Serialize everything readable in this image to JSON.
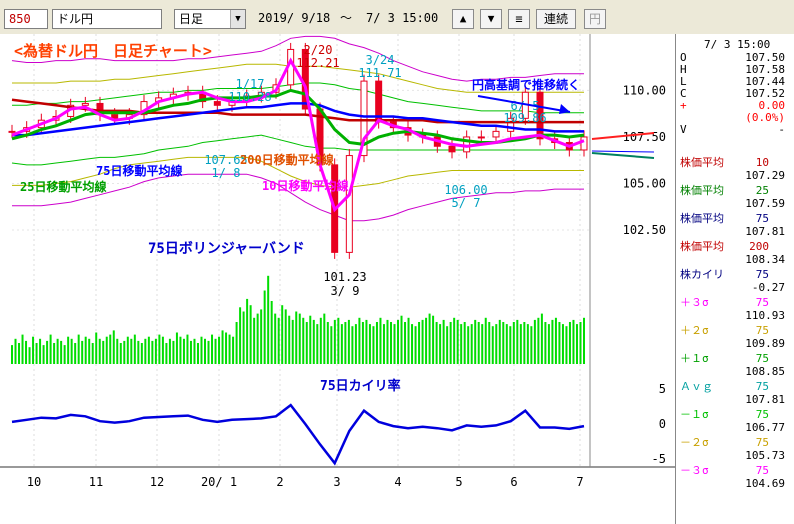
{
  "toolbar": {
    "code": "850",
    "name": "ドル円",
    "period": "日足",
    "date_from": "2019/ 9/18",
    "tilde": "～",
    "date_to": "7/ 3 15:00",
    "up_label": "▲",
    "down_label": "▼",
    "menu_label": "≡",
    "continuous_label": "連続",
    "yen_label": "円"
  },
  "colors": {
    "candle": "#e8001f",
    "ma10": "#ff00ff",
    "ma25": "#00b000",
    "ma75": "#0000ff",
    "ma200": "#c00000",
    "sigma3": "#cc00cc",
    "sigma2": "#b8b800",
    "sigma1": "#00c000",
    "volume": "#00dd00",
    "deviation": "#0000dd"
  },
  "chart_data": [
    {
      "type": "line",
      "title": "<為替ドル円　日足チャート>",
      "xlabel": "",
      "ylabel": "",
      "x_ticks": [
        "10",
        "11",
        "12",
        "20/ 1",
        "2",
        "3",
        "4",
        "5",
        "6",
        "7"
      ],
      "y_ticks": [
        "110.00",
        "107.50",
        "105.00",
        "102.50"
      ],
      "ylim": [
        100.3,
        112.6
      ],
      "series": [
        {
          "name": "株価平均 10",
          "values": [
            107.6,
            107.9,
            108.2,
            108.5,
            109.0,
            109.1,
            108.7,
            108.4,
            108.5,
            108.9,
            109.4,
            109.6,
            109.8,
            109.9,
            109.6,
            109.4,
            109.4,
            109.6,
            110.0,
            111.6,
            110.2,
            106.0,
            103.6,
            104.4,
            107.4,
            108.4,
            108.1,
            107.9,
            107.5,
            107.3,
            107.1,
            107.0,
            107.1,
            107.2,
            107.4,
            107.5,
            107.6,
            107.3,
            107.0,
            107.3
          ]
        },
        {
          "name": "株価平均 25",
          "values": [
            107.4,
            107.6,
            107.9,
            108.1,
            108.4,
            108.7,
            108.8,
            108.8,
            108.8,
            108.8,
            109.0,
            109.2,
            109.3,
            109.5,
            109.6,
            109.6,
            109.6,
            109.7,
            109.7,
            110.0,
            109.8,
            109.0,
            107.9,
            107.2,
            107.1,
            107.5,
            107.7,
            107.8,
            107.7,
            107.6,
            107.4,
            107.3,
            107.2,
            107.2,
            107.3,
            107.4,
            107.6,
            107.6,
            107.5,
            107.6
          ]
        },
        {
          "name": "株価平均 75",
          "values": [
            107.6,
            107.6,
            107.7,
            107.8,
            107.9,
            108.0,
            108.1,
            108.2,
            108.3,
            108.4,
            108.5,
            108.6,
            108.7,
            108.8,
            108.9,
            109.0,
            109.1,
            109.1,
            109.2,
            109.3,
            109.3,
            109.2,
            108.9,
            108.7,
            108.6,
            108.6,
            108.6,
            108.5,
            108.5,
            108.4,
            108.3,
            108.2,
            108.1,
            108.1,
            108.0,
            107.9,
            107.9,
            107.8,
            107.8,
            107.8
          ]
        },
        {
          "name": "株価平均 200",
          "values": [
            109.5,
            109.4,
            109.3,
            109.2,
            109.1,
            109.0,
            108.9,
            108.9,
            108.9,
            108.8,
            108.8,
            108.8,
            108.8,
            108.8,
            108.8,
            108.7,
            108.7,
            108.7,
            108.7,
            108.7,
            108.7,
            108.6,
            108.5,
            108.4,
            108.4,
            108.4,
            108.4,
            108.4,
            108.4,
            108.3,
            108.3,
            108.3,
            108.3,
            108.3,
            108.3,
            108.3,
            108.3,
            108.3,
            108.3,
            108.3
          ]
        },
        {
          "name": "+3σ",
          "values": [
            111.6,
            111.5,
            111.5,
            111.6,
            111.6,
            111.7,
            111.7,
            111.6,
            111.6,
            111.6,
            111.6,
            111.6,
            111.7,
            111.7,
            111.8,
            111.9,
            112.0,
            112.1,
            112.4,
            112.8,
            112.9,
            112.9,
            112.8,
            112.5,
            112.3,
            112.0,
            111.6,
            111.3,
            111.0,
            110.8,
            110.6,
            110.5,
            110.6,
            110.6,
            110.7,
            110.7,
            110.8,
            110.9,
            110.9,
            110.9
          ]
        },
        {
          "name": "+2σ",
          "values": [
            110.4,
            110.4,
            110.4,
            110.4,
            110.5,
            110.5,
            110.5,
            110.6,
            110.6,
            110.7,
            110.8,
            110.9,
            111.0,
            111.1,
            111.2,
            111.3,
            111.4,
            111.4,
            111.4,
            111.3,
            111.3,
            111.3,
            111.2,
            111.1,
            111.0,
            110.9,
            110.7,
            110.5,
            110.3,
            110.1,
            110.0,
            109.9,
            109.9,
            109.9,
            109.9,
            109.9,
            109.9,
            109.9,
            109.9,
            109.9
          ]
        },
        {
          "name": "+1σ",
          "values": [
            109.2,
            109.2,
            109.3,
            109.3,
            109.4,
            109.4,
            109.5,
            109.6,
            109.7,
            109.8,
            109.9,
            109.9,
            110.0,
            110.0,
            110.1,
            110.1,
            110.1,
            110.1,
            110.2,
            110.3,
            110.4,
            110.4,
            110.3,
            110.1,
            110.0,
            109.8,
            109.6,
            109.4,
            109.3,
            109.2,
            109.1,
            109.0,
            108.9,
            108.9,
            108.9,
            108.9,
            108.8,
            108.8,
            108.8,
            108.8
          ]
        },
        {
          "name": "-1σ",
          "values": [
            106.1,
            106.0,
            106.0,
            106.1,
            106.2,
            106.3,
            106.4,
            106.4,
            106.5,
            106.6,
            106.8,
            106.9,
            107.0,
            107.2,
            107.3,
            107.4,
            107.5,
            107.6,
            107.4,
            107.2,
            107.0,
            106.9,
            106.9,
            106.8,
            106.8,
            106.8,
            106.8,
            106.8,
            106.8,
            106.8,
            106.8,
            106.8,
            106.8,
            106.8,
            106.8,
            106.8,
            106.8,
            106.8,
            106.8,
            106.8
          ]
        },
        {
          "name": "-2σ",
          "values": [
            104.9,
            104.9,
            104.9,
            105.0,
            105.1,
            105.3,
            105.5,
            105.8,
            106.0,
            106.1,
            106.2,
            106.3,
            106.4,
            106.4,
            106.4,
            106.4,
            106.4,
            106.2,
            105.8,
            105.4,
            105.1,
            104.9,
            104.8,
            104.8,
            104.9,
            105.0,
            105.2,
            105.4,
            105.5,
            105.6,
            105.7,
            105.7,
            105.7,
            105.7,
            105.7,
            105.7,
            105.7,
            105.7,
            105.7,
            105.7
          ]
        },
        {
          "name": "-3σ",
          "values": [
            103.8,
            103.8,
            103.8,
            103.9,
            104.0,
            104.2,
            104.4,
            104.6,
            104.8,
            105.1,
            105.3,
            105.4,
            105.5,
            105.5,
            105.5,
            105.5,
            105.5,
            105.3,
            105.0,
            104.5,
            104.0,
            103.6,
            103.3,
            103.0,
            103.0,
            103.1,
            103.3,
            103.6,
            103.8,
            104.0,
            104.2,
            104.3,
            104.4,
            104.5,
            104.5,
            104.6,
            104.6,
            104.7,
            104.7,
            104.7
          ]
        },
        {
          "name": "ドル円",
          "values": [
            107.8,
            108.0,
            108.4,
            108.6,
            109.2,
            109.3,
            108.7,
            108.5,
            108.7,
            109.4,
            109.6,
            109.8,
            109.9,
            109.4,
            109.2,
            109.4,
            109.7,
            109.9,
            110.3,
            112.2,
            109.0,
            106.0,
            101.3,
            106.5,
            110.5,
            108.3,
            108.0,
            107.6,
            107.5,
            107.0,
            106.7,
            107.5,
            107.5,
            107.8,
            108.5,
            109.9,
            107.4,
            107.2,
            106.8,
            107.5
          ]
        }
      ],
      "annotations": [
        "2/20\n112.21",
        "3/24\n111.71",
        "1/17\n110.28",
        "6/ 5\n109.86",
        "107.65\n1/ 8",
        "101.23\n3/ 9",
        "106.00\n5/ 7",
        "円高基調で推移続く",
        "75日移動平均線",
        "25日移動平均線",
        "200日移動平均線",
        "10日移動平均線",
        "75日ボリンジャーバンド"
      ]
    },
    {
      "type": "bar",
      "title": "",
      "values": [
        9,
        12,
        10,
        14,
        11,
        8,
        13,
        10,
        12,
        9,
        11,
        14,
        10,
        12,
        11,
        9,
        13,
        12,
        10,
        14,
        11,
        13,
        12,
        10,
        15,
        12,
        11,
        13,
        14,
        16,
        12,
        10,
        11,
        13,
        12,
        14,
        11,
        10,
        12,
        13,
        11,
        12,
        14,
        13,
        10,
        12,
        11,
        15,
        13,
        12,
        14,
        11,
        12,
        10,
        13,
        12,
        11,
        14,
        12,
        13,
        16,
        15,
        14,
        13,
        20,
        27,
        25,
        31,
        28,
        22,
        24,
        26,
        35,
        42,
        30,
        24,
        22,
        28,
        26,
        23,
        21,
        25,
        24,
        22,
        20,
        23,
        21,
        19,
        22,
        24,
        20,
        18,
        21,
        22,
        19,
        20,
        21,
        18,
        19,
        22,
        20,
        21,
        19,
        18,
        20,
        22,
        19,
        21,
        20,
        19,
        21,
        23,
        20,
        22,
        19,
        18,
        20,
        21,
        22,
        24,
        23,
        20,
        19,
        21,
        18,
        20,
        22,
        21,
        19,
        20,
        18,
        19,
        21,
        20,
        19,
        22,
        20,
        18,
        19,
        21,
        20,
        19,
        18,
        20,
        21,
        19,
        20,
        19,
        18,
        21,
        22,
        24,
        20,
        19,
        21,
        22,
        20,
        19,
        18,
        20,
        21,
        19,
        20,
        22
      ]
    },
    {
      "type": "line",
      "title": "75日カイリ率",
      "y_ticks": [
        "5",
        "0",
        "-5"
      ],
      "ylim": [
        -6,
        6
      ],
      "series": [
        {
          "name": "75日カイリ率",
          "values": [
            0.3,
            0.6,
            0.9,
            0.8,
            1.3,
            1.1,
            0.4,
            0.2,
            0.4,
            0.9,
            1.0,
            1.1,
            1.2,
            0.6,
            0.3,
            0.6,
            0.7,
            0.8,
            1.1,
            2.7,
            0.0,
            -2.9,
            -5.6,
            -1.0,
            1.9,
            0.3,
            -0.3,
            -0.6,
            -0.4,
            -0.6,
            -0.9,
            -0.2,
            -0.4,
            -0.2,
            0.4,
            1.9,
            -0.5,
            -0.5,
            -0.7,
            -0.3
          ]
        }
      ]
    }
  ],
  "panel": {
    "datetime": "7/ 3 15:00",
    "ohlc": [
      {
        "k": "O",
        "v": "107.50"
      },
      {
        "k": "H",
        "v": "107.58"
      },
      {
        "k": "L",
        "v": "107.44"
      },
      {
        "k": "C",
        "v": "107.52"
      },
      {
        "k": "+",
        "v": "0.00"
      },
      {
        "k": "",
        "v": "(0.0%)"
      },
      {
        "k": "V",
        "v": "-"
      }
    ],
    "indicators": [
      {
        "label": "株価平均",
        "period": "10",
        "value": "107.29"
      },
      {
        "label": "株価平均",
        "period": "25",
        "value": "107.59"
      },
      {
        "label": "株価平均",
        "period": "75",
        "value": "107.81"
      },
      {
        "label": "株価平均",
        "period": "200",
        "value": "108.34"
      },
      {
        "label": "株カイリ",
        "period": "75",
        "value": "-0.27"
      },
      {
        "label": "＋３σ",
        "period": "75",
        "value": "110.93"
      },
      {
        "label": "＋２σ",
        "period": "75",
        "value": "109.89"
      },
      {
        "label": "＋１σ",
        "period": "75",
        "value": "108.85"
      },
      {
        "label": "Ａｖｇ",
        "period": "75",
        "value": "107.81"
      },
      {
        "label": "－１σ",
        "period": "75",
        "value": "106.77"
      },
      {
        "label": "－２σ",
        "period": "75",
        "value": "105.73"
      },
      {
        "label": "－３σ",
        "period": "75",
        "value": "104.69"
      }
    ]
  }
}
